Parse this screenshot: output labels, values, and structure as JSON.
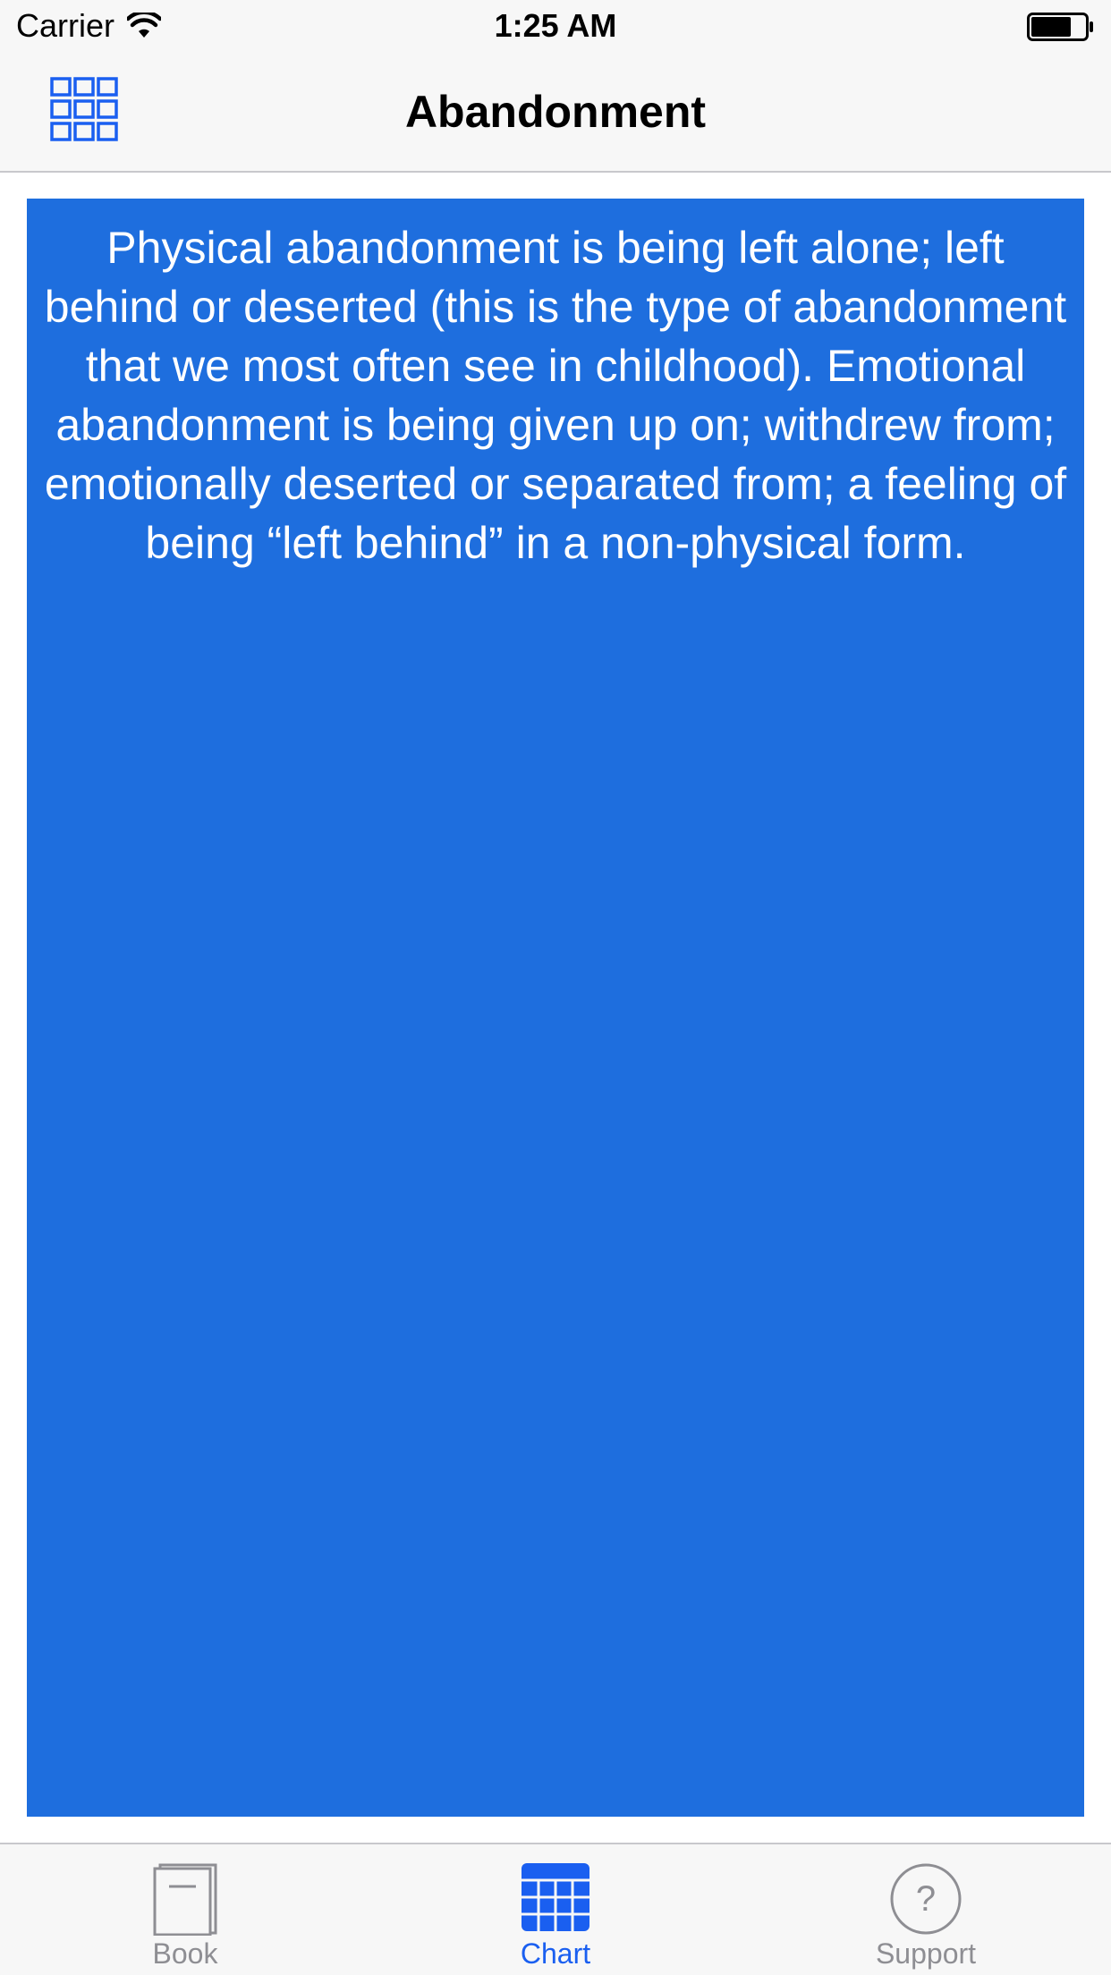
{
  "status_bar": {
    "carrier": "Carrier",
    "time": "1:25 AM"
  },
  "nav": {
    "title": "Abandonment",
    "left_icon": "grid-icon"
  },
  "content": {
    "text": "Physical abandonment is being left alone; left behind or deserted (this is the type of abandonment that we most often see in childhood). Emotional abandonment is being given up on; withdrew from; emotionally deserted or separated from; a feeling of being “left behind” in a non-physical form.",
    "background_color": "#1e6ede"
  },
  "tabs": [
    {
      "label": "Book",
      "icon": "book-icon",
      "active": false
    },
    {
      "label": "Chart",
      "icon": "chart-grid-icon",
      "active": true
    },
    {
      "label": "Support",
      "icon": "question-circle-icon",
      "active": false
    }
  ],
  "colors": {
    "accent": "#1a5ff0",
    "inactive": "#8e8e93",
    "bar_background": "#f7f7f7"
  }
}
